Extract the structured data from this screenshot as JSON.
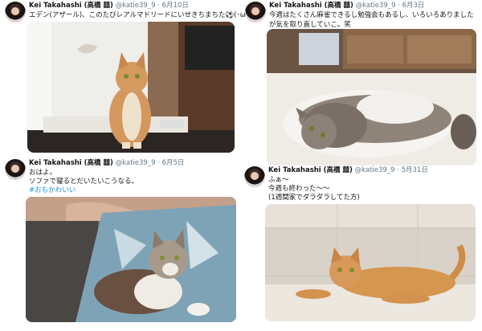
{
  "tweets": [
    {
      "name": "Kei Takahashi (高橋 囍)",
      "handle": "@katie39_9",
      "separator": "·",
      "date": "6月10日",
      "lines": [
        "エデン(アザール)、このたびレアルマドリードにいせきちまちた⚽(･ω･`)"
      ],
      "photo": "orange tabby cat sitting upright on a table in a white room"
    },
    {
      "name": "Kei Takahashi (高橋 囍)",
      "handle": "@katie39_9",
      "separator": "·",
      "date": "6月3日",
      "lines": [
        "今週はたくさん麻雀できるし勉強会もあるし、いろいろありましたが気を取り直していこ。笑"
      ],
      "photo": "grey tabby cat lying on its back on a fluffy rug"
    },
    {
      "name": "Kei Takahashi (高橋 囍)",
      "handle": "@katie39_9",
      "separator": "·",
      "date": "6月5日",
      "lines": [
        "おはよ。",
        "ソファで寝るとだいたいこうなる。"
      ],
      "hashtag": "#おもかわいい",
      "photo": "calico cat lying on a patterned blanket on a sofa"
    },
    {
      "name": "Kei Takahashi (高橋 囍)",
      "handle": "@katie39_9",
      "separator": "·",
      "date": "5月31日",
      "lines": [
        "ふぁ〜",
        "今週も終わった〜〜",
        "(1週間家でダラダラしてた方)"
      ],
      "photo": "orange cat stretched out on a marble floor"
    }
  ]
}
